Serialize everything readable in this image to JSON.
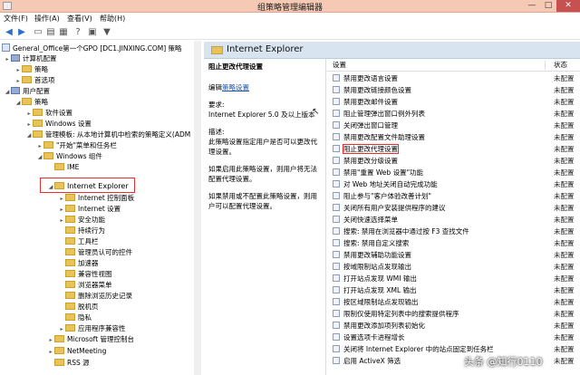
{
  "window": {
    "title": "组策略管理编辑器",
    "minimize": "—",
    "maximize": "□",
    "close": "✕"
  },
  "menu": [
    "文件(F)",
    "操作(A)",
    "查看(V)",
    "帮助(H)"
  ],
  "toolbar": [
    "back-icon",
    "forward-icon",
    "up-icon",
    "view-icon",
    "properties-icon",
    "help-icon",
    "help2-icon",
    "filter-icon"
  ],
  "tree": [
    {
      "label": "General_Office第一个GPO [DC1.JINXING.COM] 策略",
      "icon": "doc"
    },
    {
      "label": "计算机配置",
      "icon": "pc",
      "arrow": "▸"
    },
    {
      "label": "策略",
      "icon": "folder",
      "arrow": "▸"
    },
    {
      "label": "首选项",
      "icon": "folder",
      "arrow": "▸"
    },
    {
      "label": "用户配置",
      "icon": "pc",
      "arrow": "◢"
    },
    {
      "label": "策略",
      "icon": "folder",
      "arrow": "◢"
    },
    {
      "label": "软件设置",
      "icon": "folder",
      "arrow": "▸"
    },
    {
      "label": "Windows 设置",
      "icon": "folder",
      "arrow": "▸"
    },
    {
      "label": "管理模板: 从本地计算机中检索的策略定义(ADM",
      "icon": "folder",
      "arrow": "◢"
    },
    {
      "label": "\"开始\"菜单和任务栏",
      "icon": "folder",
      "arrow": "▸"
    },
    {
      "label": "Windows 组件",
      "icon": "folder",
      "arrow": "◢"
    },
    {
      "label": "IME",
      "icon": "folder",
      "arrow": ""
    },
    {
      "label": "Internet Explorer",
      "icon": "folder",
      "arrow": "◢"
    },
    {
      "label": "Internet 控制面板",
      "icon": "folder",
      "arrow": "▸"
    },
    {
      "label": "Internet 设置",
      "icon": "folder",
      "arrow": "▸"
    },
    {
      "label": "安全功能",
      "icon": "folder",
      "arrow": "▸"
    },
    {
      "label": "持续行为",
      "icon": "folder",
      "arrow": ""
    },
    {
      "label": "工具栏",
      "icon": "folder",
      "arrow": ""
    },
    {
      "label": "管理员认可的控件",
      "icon": "folder",
      "arrow": ""
    },
    {
      "label": "加速器",
      "icon": "folder",
      "arrow": ""
    },
    {
      "label": "兼容性视图",
      "icon": "folder",
      "arrow": ""
    },
    {
      "label": "浏览器菜单",
      "icon": "folder",
      "arrow": ""
    },
    {
      "label": "删除浏览历史记录",
      "icon": "folder",
      "arrow": ""
    },
    {
      "label": "脱机页",
      "icon": "folder",
      "arrow": ""
    },
    {
      "label": "隐私",
      "icon": "folder",
      "arrow": ""
    },
    {
      "label": "应用程序兼容性",
      "icon": "folder",
      "arrow": "▸"
    },
    {
      "label": "Microsoft 管理控制台",
      "icon": "folder",
      "arrow": "▸"
    },
    {
      "label": "NetMeeting",
      "icon": "folder",
      "arrow": "▸"
    },
    {
      "label": "RSS 源",
      "icon": "folder",
      "arrow": ""
    }
  ],
  "right_pane": {
    "title": "Internet Explorer",
    "desc_title": "阻止更改代理设置",
    "edit_prefix": "编辑",
    "edit_link": "策略设置",
    "req_label": "要求:",
    "req_text": "Internet Explorer 5.0 及以上版本",
    "desc_label": "描述:",
    "desc_text": "此策略设置指定用户是否可以更改代理设置。",
    "enabled_text": "如果启用此策略设置，则用户将无法配置代理设置。",
    "disabled_text": "如果禁用或不配置此策略设置，则用户可以配置代理设置。"
  },
  "list": {
    "col_setting": "设置",
    "col_state": "状态",
    "rows": [
      {
        "name": "禁用更改语言设置",
        "state": "未配置"
      },
      {
        "name": "禁用更改链接颜色设置",
        "state": "未配置"
      },
      {
        "name": "禁用更改邮件设置",
        "state": "未配置"
      },
      {
        "name": "阻止管理弹出窗口例外列表",
        "state": "未配置"
      },
      {
        "name": "关闭弹出窗口管理",
        "state": "未配置"
      },
      {
        "name": "禁用更改配置文件助理设置",
        "state": "未配置"
      },
      {
        "name": "阻止更改代理设置",
        "state": "未配置",
        "selected": true
      },
      {
        "name": "禁用更改分级设置",
        "state": "未配置"
      },
      {
        "name": "禁用\"重置 Web 设置\"功能",
        "state": "未配置"
      },
      {
        "name": "对 Web 地址关闭自动完成功能",
        "state": "未配置"
      },
      {
        "name": "阻止参与\"客户体验改善计划\"",
        "state": "未配置"
      },
      {
        "name": "关闭所有用户安装提供程序的建议",
        "state": "未配置"
      },
      {
        "name": "关闭快速选择菜单",
        "state": "未配置"
      },
      {
        "name": "搜索: 禁用在浏览器中通过按 F3 查找文件",
        "state": "未配置"
      },
      {
        "name": "搜索: 禁用自定义搜索",
        "state": "未配置"
      },
      {
        "name": "禁用更改辅助功能设置",
        "state": "未配置"
      },
      {
        "name": "按域限制站点发现输出",
        "state": "未配置"
      },
      {
        "name": "打开站点发现 WMI 输出",
        "state": "未配置"
      },
      {
        "name": "打开站点发现 XML 输出",
        "state": "未配置"
      },
      {
        "name": "按区域限制站点发现输出",
        "state": "未配置"
      },
      {
        "name": "限制仅使用特定列表中的搜索提供程序",
        "state": "未配置"
      },
      {
        "name": "禁用更改添加项列表初始化",
        "state": "未配置"
      },
      {
        "name": "设置选项卡进程增长",
        "state": "未配置"
      },
      {
        "name": "关闭将 Internet Explorer 中的站点固定到任务栏",
        "state": "未配置"
      },
      {
        "name": "启用 ActiveX 筛选",
        "state": "未配置"
      }
    ]
  },
  "watermark": "头条 @知行0110"
}
